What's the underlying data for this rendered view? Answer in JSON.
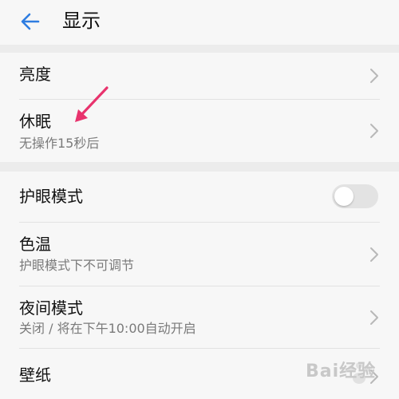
{
  "header": {
    "title": "显示",
    "back_icon": "back-arrow-icon",
    "accent_color": "#2f7de1"
  },
  "settings": [
    {
      "id": "brightness",
      "label": "亮度"
    },
    {
      "id": "sleep",
      "label": "休眠",
      "sub": "无操作15秒后"
    },
    {
      "id": "eye-comfort",
      "label": "护眼模式",
      "toggle_on": false
    },
    {
      "id": "color-temp",
      "label": "色温",
      "sub": "护眼模式下不可调节"
    },
    {
      "id": "night-mode",
      "label": "夜间模式",
      "sub": "关闭 / 将在下午10:00自动开启"
    },
    {
      "id": "wallpaper",
      "label": "壁纸"
    }
  ],
  "annotation": {
    "arrow_color": "#e8336d"
  },
  "watermark": {
    "text": "Bai经验"
  }
}
